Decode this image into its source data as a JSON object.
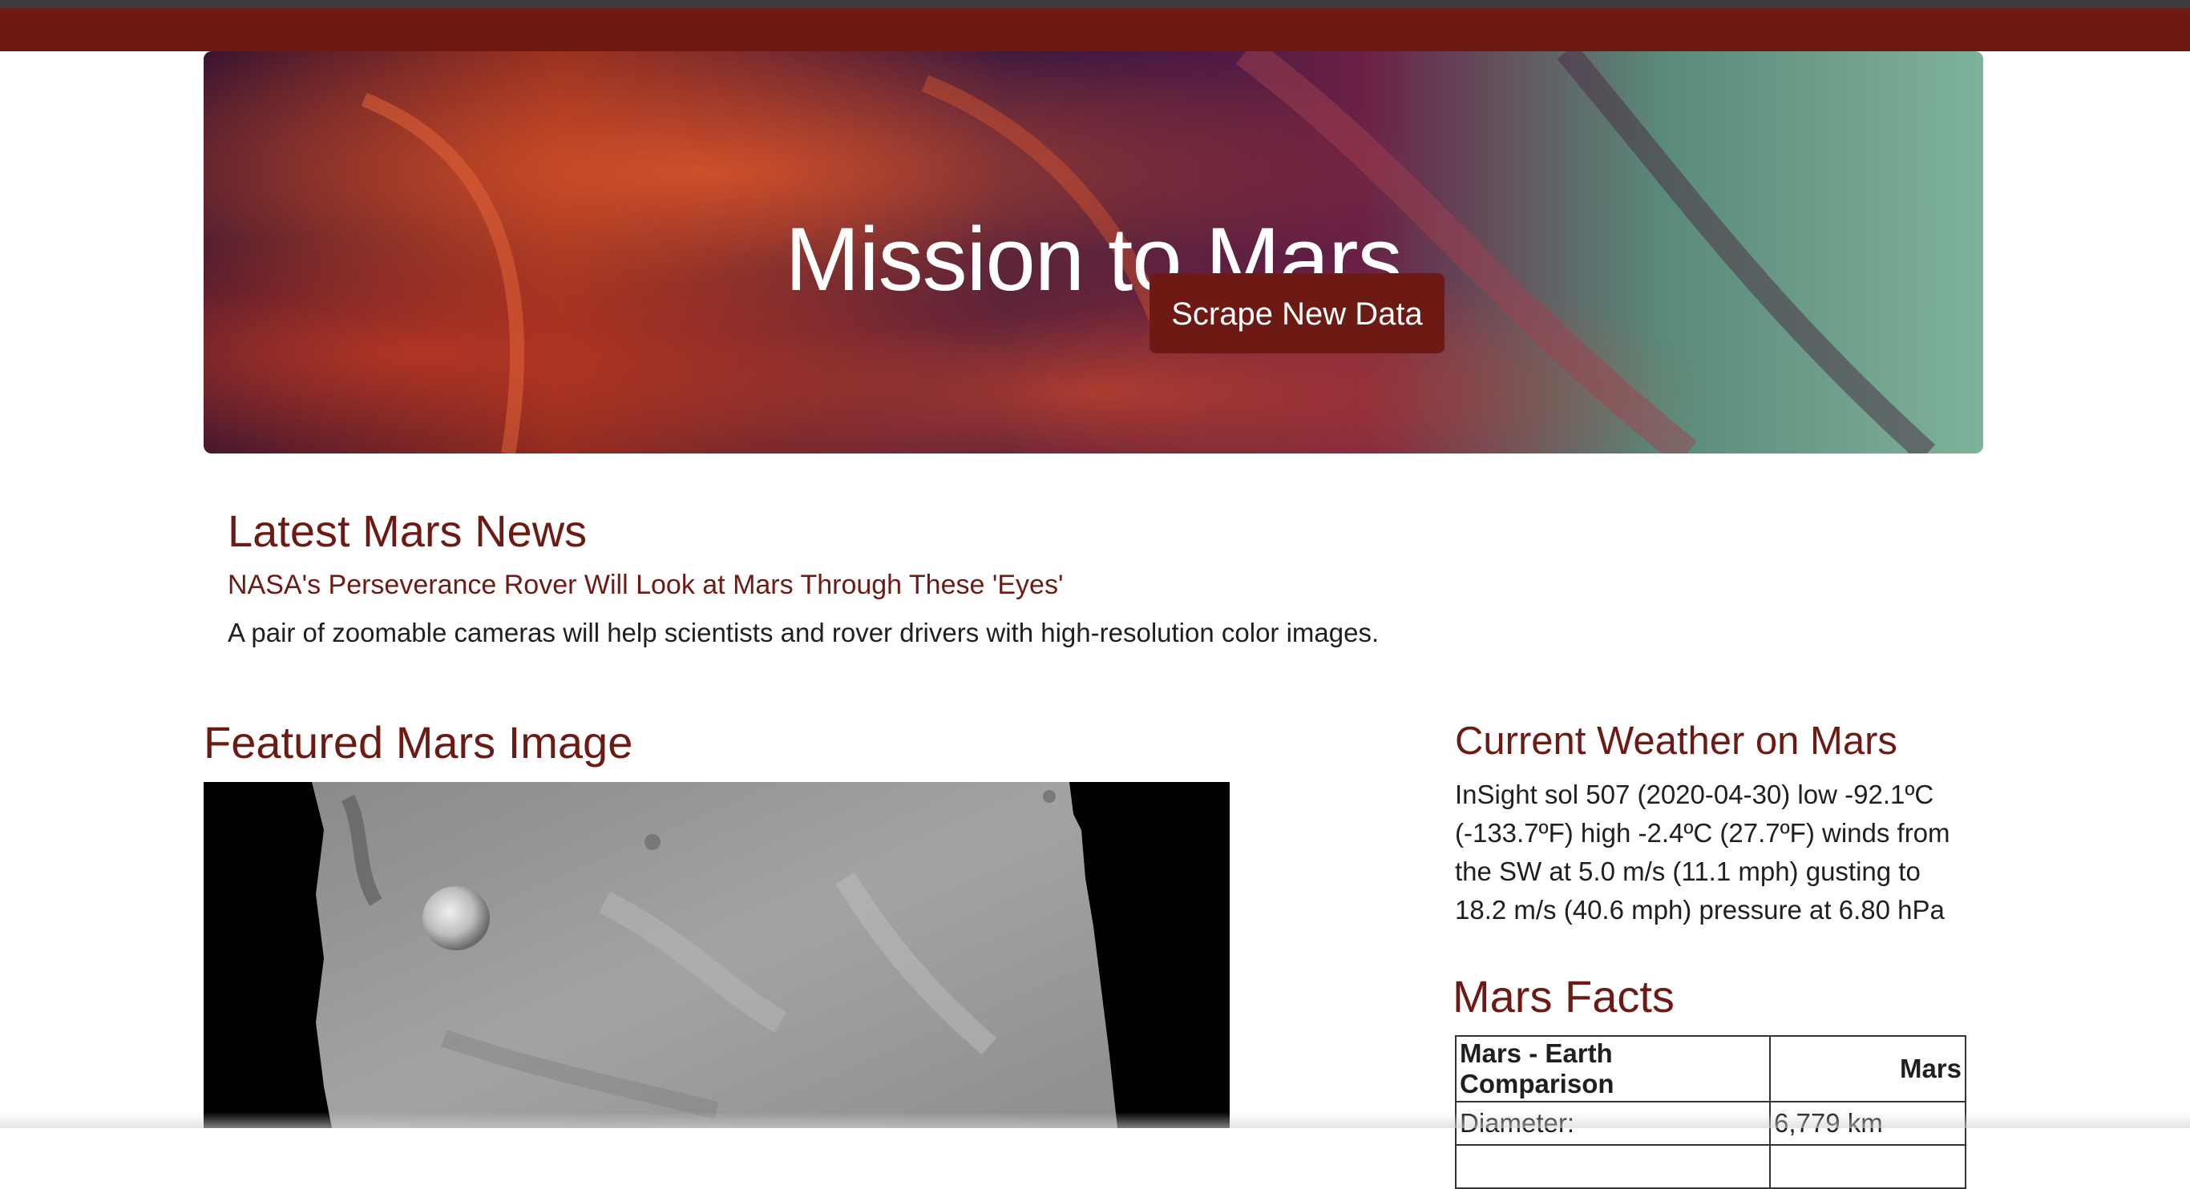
{
  "page_title": "Mission to Mars",
  "hero": {
    "title": "Mission to Mars",
    "button_label": "Scrape New Data"
  },
  "news": {
    "heading": "Latest Mars News",
    "title": "NASA's Perseverance Rover Will Look at Mars Through These 'Eyes'",
    "teaser": "A pair of zoomable cameras will help scientists and rover drivers with high-resolution color images."
  },
  "featured": {
    "heading": "Featured Mars Image"
  },
  "weather": {
    "heading": "Current Weather on Mars",
    "text": "InSight sol 507 (2020-04-30) low -92.1ºC (-133.7ºF) high -2.4ºC (27.7ºF) winds from the SW at 5.0 m/s (11.1 mph) gusting to 18.2 m/s (40.6 mph) pressure at 6.80 hPa"
  },
  "facts": {
    "heading": "Mars Facts",
    "columns": [
      "Mars - Earth Comparison",
      "Mars"
    ],
    "rows": [
      [
        "Diameter:",
        "6,779 km"
      ],
      [
        "",
        ""
      ]
    ]
  },
  "colors": {
    "accent": "#6e1a14",
    "top_strip": "#3d3d3d",
    "text": "#1f1f1f"
  },
  "icons": []
}
